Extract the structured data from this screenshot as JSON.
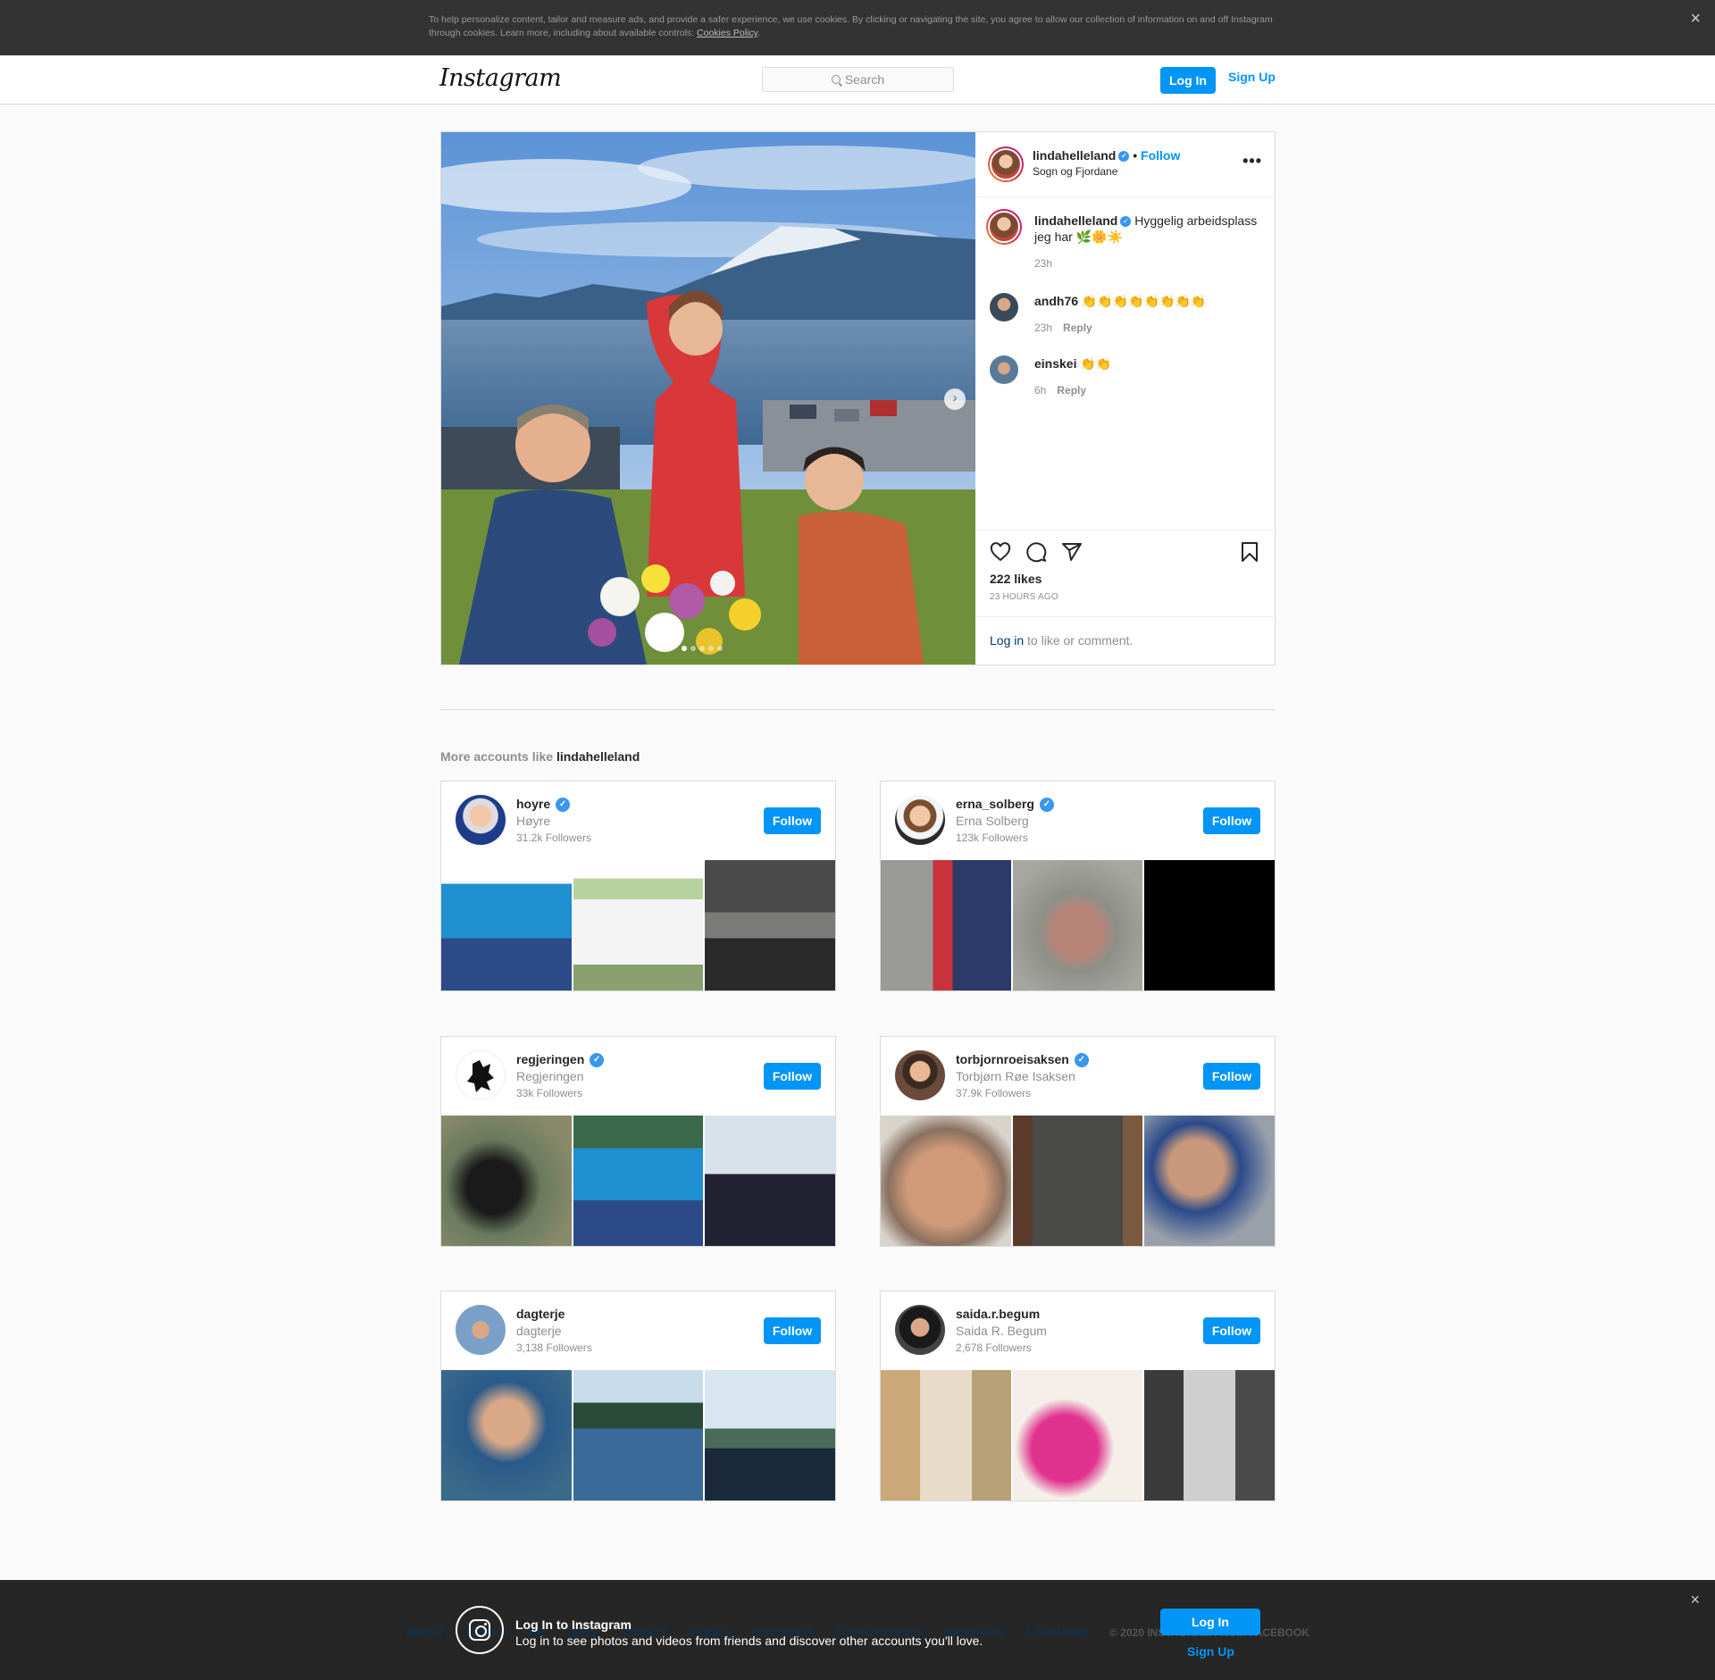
{
  "cookie_banner": {
    "text": "To help personalize content, tailor and measure ads, and provide a safer experience, we use cookies. By clicking or navigating the site, you agree to allow our collection of information on and off Instagram through cookies. Learn more, including about available controls: ",
    "link": "Cookies Policy",
    "close": "×"
  },
  "nav": {
    "logo": "Instagram",
    "search_placeholder": "Search",
    "login": "Log In",
    "signup": "Sign Up"
  },
  "post": {
    "username": "lindahelleland",
    "follow": "Follow",
    "location": "Sogn og Fjordane",
    "more": "•••",
    "caption": "Hyggelig arbeidsplass jeg har 🌿🌼☀️",
    "caption_time": "23h",
    "comments": [
      {
        "user": "andh76",
        "text": "👏👏👏👏👏👏👏👏",
        "time": "23h",
        "reply": "Reply"
      },
      {
        "user": "einskei",
        "text": "👏👏",
        "time": "6h",
        "reply": "Reply"
      }
    ],
    "likes": "222 likes",
    "time_ago": "23 HOURS AGO",
    "login_link": "Log in",
    "login_suffix": " to like or comment."
  },
  "more_accounts": {
    "prefix": "More accounts like ",
    "user": "lindahelleland",
    "follow_label": "Follow",
    "cards": [
      {
        "username": "hoyre",
        "fullname": "Høyre",
        "followers": "31.2k Followers",
        "verified": true
      },
      {
        "username": "erna_solberg",
        "fullname": "Erna Solberg",
        "followers": "123k Followers",
        "verified": true
      },
      {
        "username": "regjeringen",
        "fullname": "Regjeringen",
        "followers": "33k Followers",
        "verified": true
      },
      {
        "username": "torbjornroeisaksen",
        "fullname": "Torbjørn Røe Isaksen",
        "followers": "37.9k Followers",
        "verified": true
      },
      {
        "username": "dagterje",
        "fullname": "dagterje",
        "followers": "3,138 Followers",
        "verified": false
      },
      {
        "username": "saida.r.begum",
        "fullname": "Saida R. Begum",
        "followers": "2,678 Followers",
        "verified": false
      }
    ]
  },
  "footer": {
    "links": [
      "ABOUT",
      "PRESS",
      "API",
      "JOBS",
      "PRIVACY",
      "TERMS",
      "LOCATIONS",
      "TOP ACCOUNTS",
      "HASHTAGS",
      "LANGUAGE"
    ],
    "copyright": "© 2020 INSTAGRAM FROM FACEBOOK"
  },
  "login_popup": {
    "title": "Log In to Instagram",
    "subtitle": "Log in to see photos and videos from friends and discover other accounts you'll love.",
    "login": "Log In",
    "signup": "Sign Up",
    "close": "×"
  }
}
